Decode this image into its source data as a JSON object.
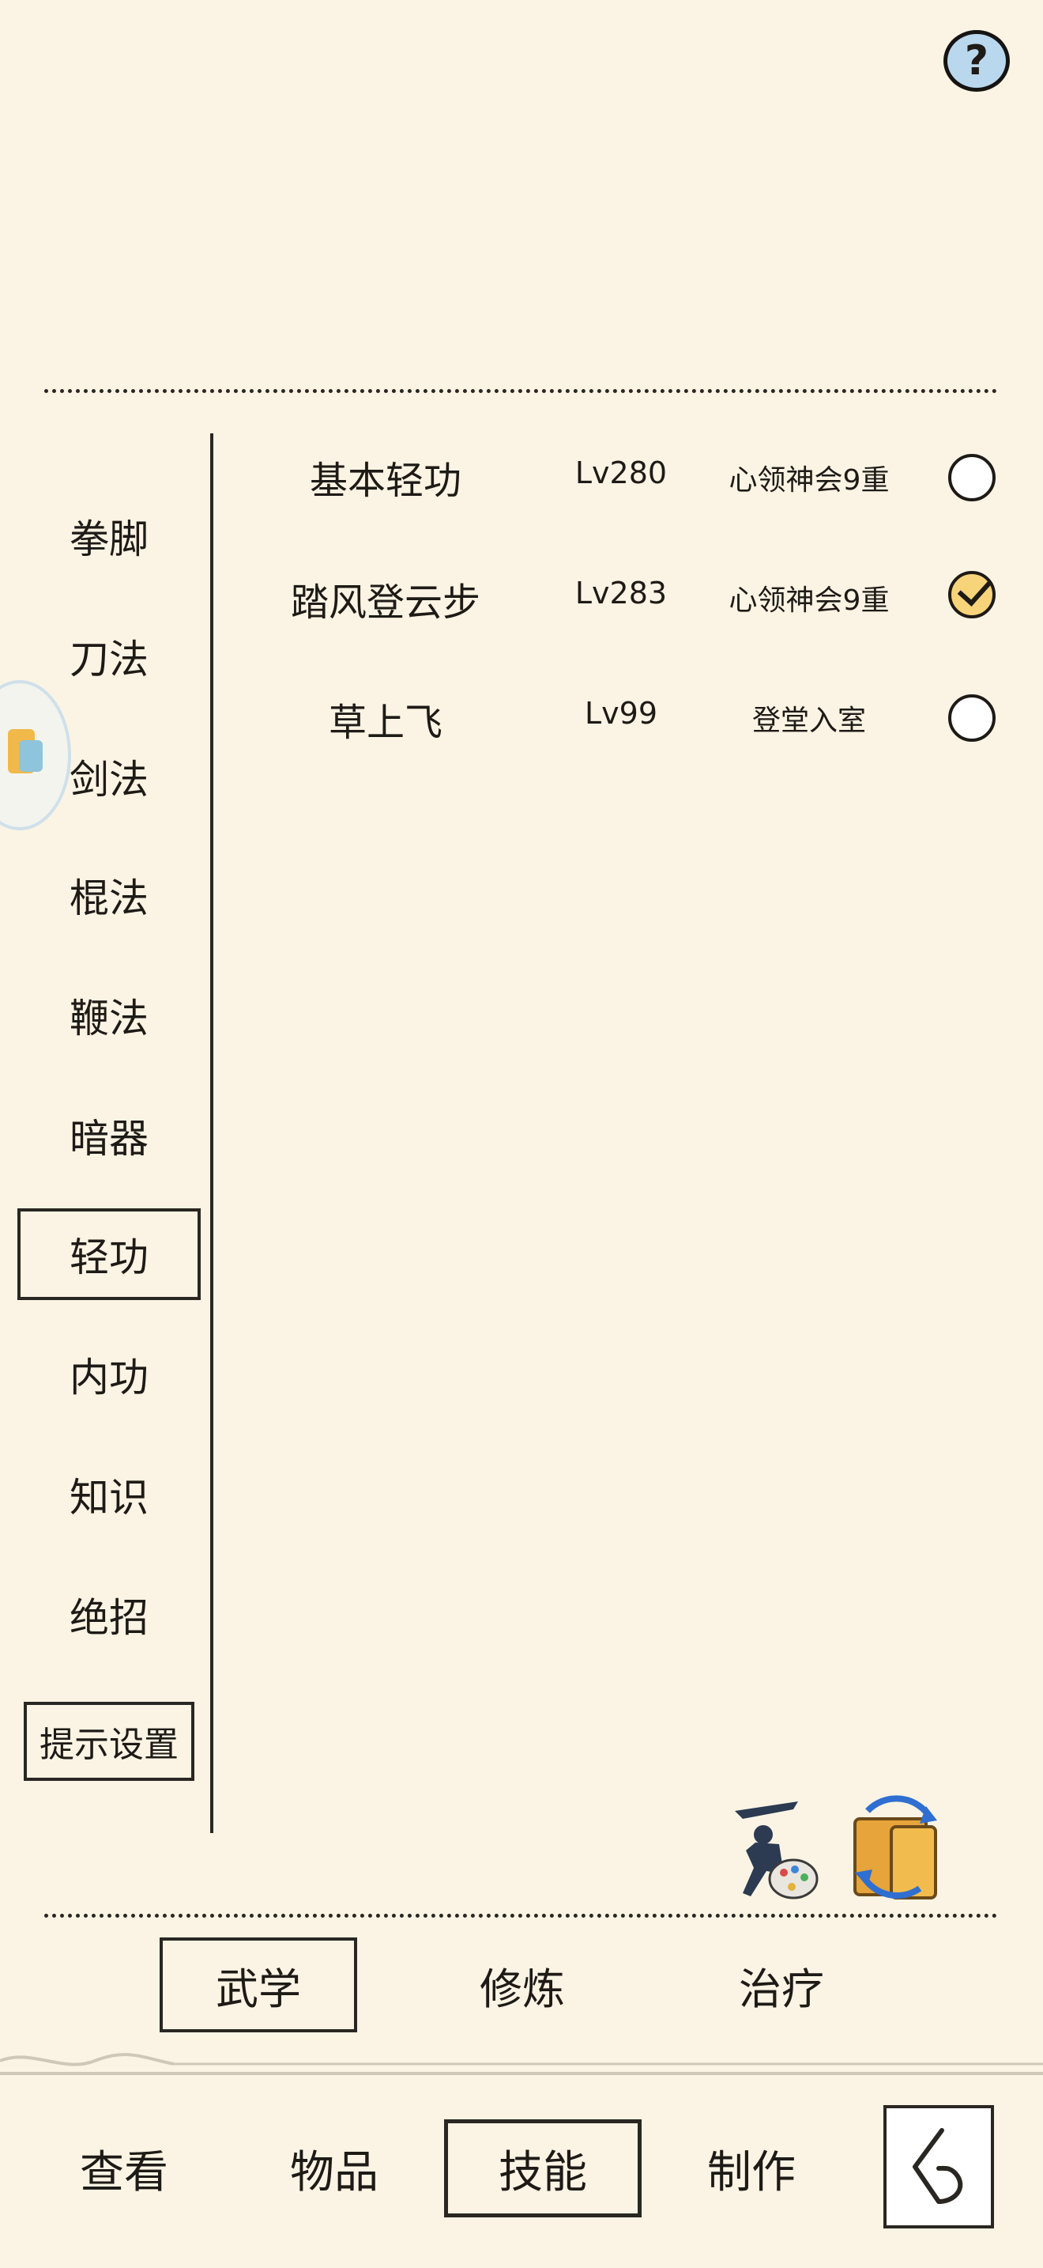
{
  "help": {
    "label": "?"
  },
  "categories": [
    {
      "label": "拳脚",
      "active": false
    },
    {
      "label": "刀法",
      "active": false
    },
    {
      "label": "剑法",
      "active": false
    },
    {
      "label": "棍法",
      "active": false
    },
    {
      "label": "鞭法",
      "active": false
    },
    {
      "label": "暗器",
      "active": false
    },
    {
      "label": "轻功",
      "active": true
    },
    {
      "label": "内功",
      "active": false
    },
    {
      "label": "知识",
      "active": false
    },
    {
      "label": "绝招",
      "active": false
    }
  ],
  "hint_settings": {
    "label": "提示设置"
  },
  "skills": [
    {
      "name": "基本轻功",
      "level": "Lv280",
      "state": "心领神会9重",
      "selected": false
    },
    {
      "name": "踏风登云步",
      "level": "Lv283",
      "state": "心领神会9重",
      "selected": true
    },
    {
      "name": "草上飞",
      "level": "Lv99",
      "state": "登堂入室",
      "selected": false
    }
  ],
  "subtabs": [
    {
      "label": "武学",
      "active": true
    },
    {
      "label": "修炼",
      "active": false
    },
    {
      "label": "治疗",
      "active": false
    }
  ],
  "navtabs": [
    {
      "label": "查看",
      "active": false
    },
    {
      "label": "物品",
      "active": false
    },
    {
      "label": "技能",
      "active": true
    },
    {
      "label": "制作",
      "active": false
    }
  ],
  "icons": {
    "help": "question-icon",
    "warrior": "warrior-palette-icon",
    "book": "book-refresh-icon",
    "back": "back-arrow-icon",
    "floating": "floating-assistant-icon"
  },
  "colors": {
    "background": "#fbf4e4",
    "checked": "#f7d47a",
    "help": "#b9d8ee"
  }
}
